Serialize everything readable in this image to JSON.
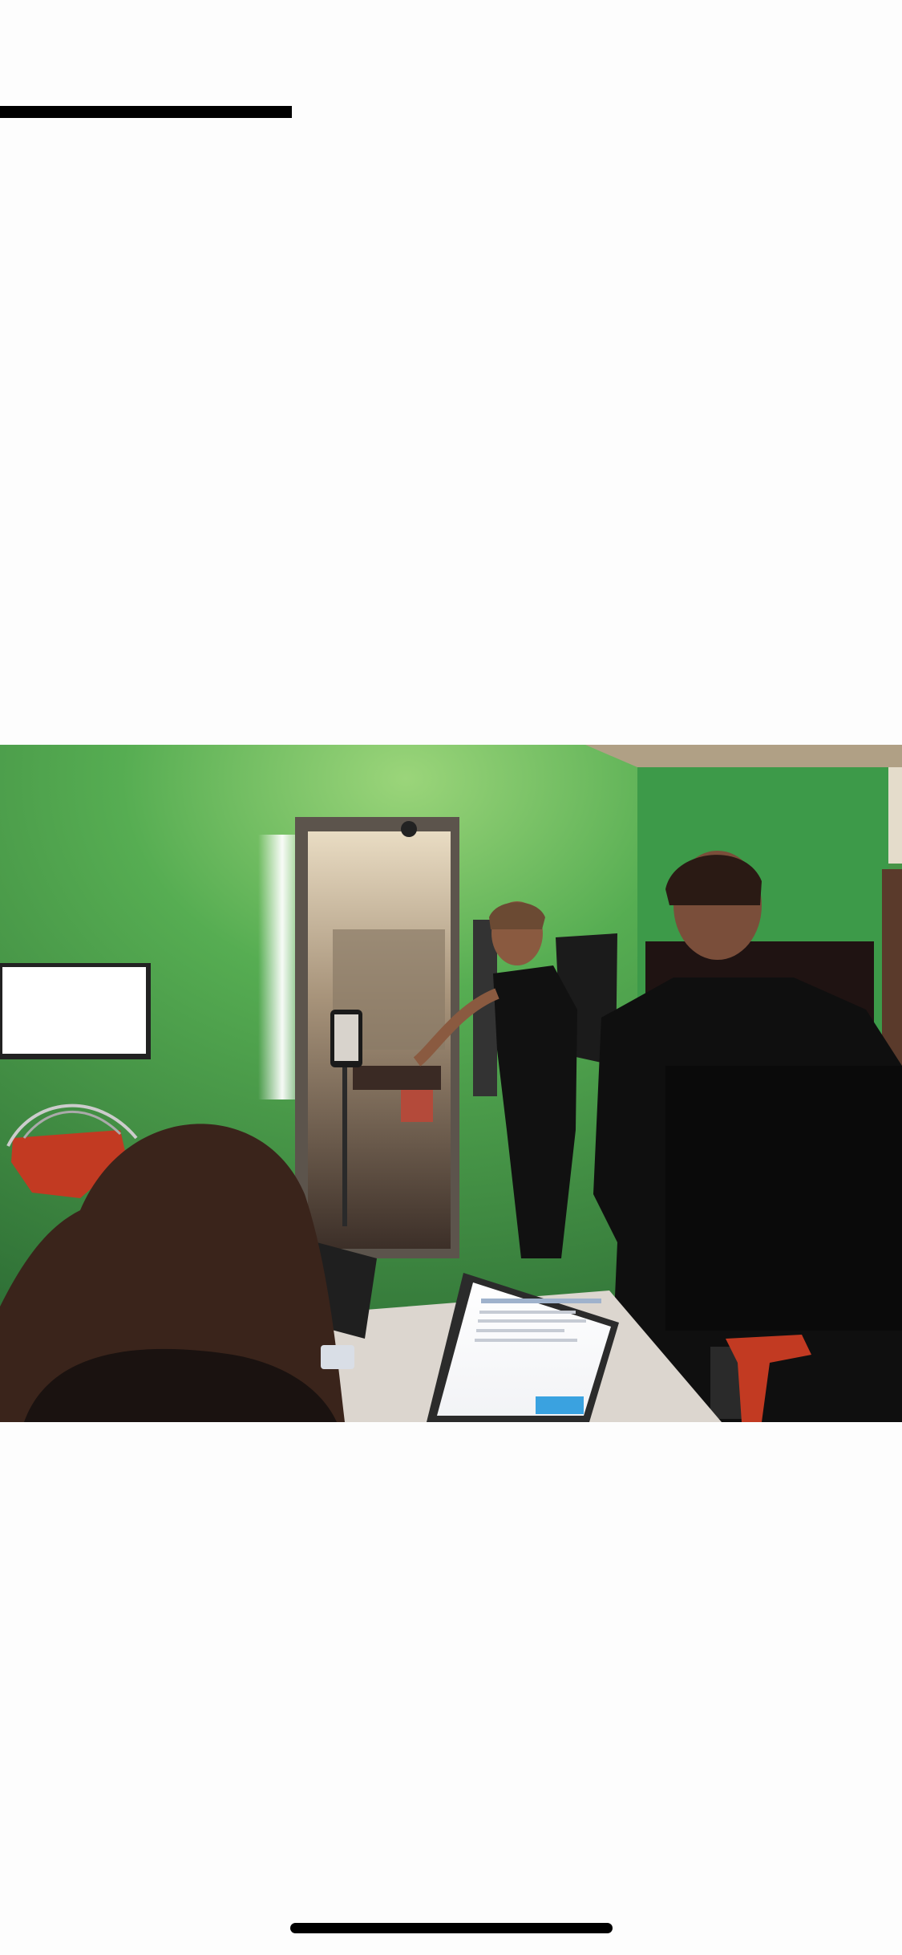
{
  "screen": {
    "background_color": "#fdfdfd"
  },
  "photo": {
    "subject": "photograph"
  },
  "colors": {
    "wall": "#47a04a",
    "wall_highlight": "#86c66b",
    "ceiling": "#b0a085",
    "dark_clothing": "#111111",
    "hair": "#3a241b",
    "red_device": "#c23a22"
  },
  "icons": {
    "top_bar": "progress-bar",
    "home": "home-indicator-icon"
  }
}
